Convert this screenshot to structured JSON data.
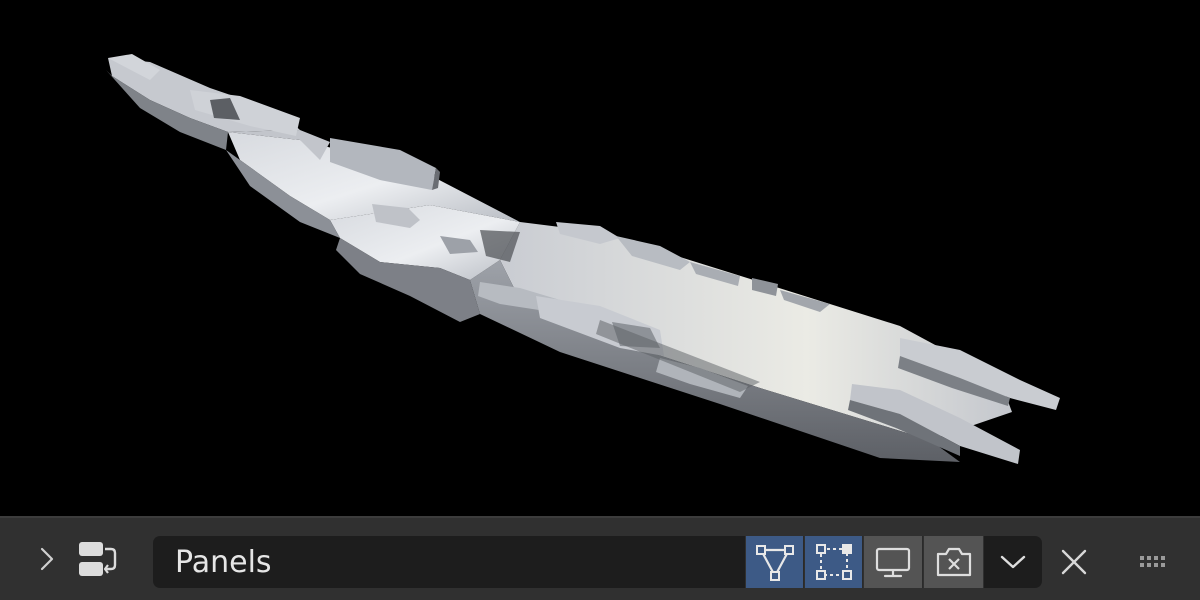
{
  "viewport": {
    "background": "#000000",
    "model": "spaceship-render"
  },
  "modifier_panel": {
    "expand_icon": "chevron-right-icon",
    "type_icon": "modifier-node-icon",
    "name_value": "Panels",
    "toggles": {
      "on_cage": {
        "icon": "on-cage-triangle-icon",
        "active": true
      },
      "edit_mode": {
        "icon": "edit-mode-vertices-icon",
        "active": true
      },
      "viewport": {
        "icon": "monitor-icon",
        "active": false
      },
      "render": {
        "icon": "camera-icon",
        "active": false
      }
    },
    "dropdown_icon": "chevron-down-icon",
    "delete_icon": "close-icon",
    "drag_icon": "grip-dots-icon"
  },
  "colors": {
    "active_toggle": "#3d5a86",
    "inactive_toggle": "#545454",
    "field_bg": "#1d1d1d",
    "panel_bg": "#303030",
    "text": "#e6e6e6"
  }
}
